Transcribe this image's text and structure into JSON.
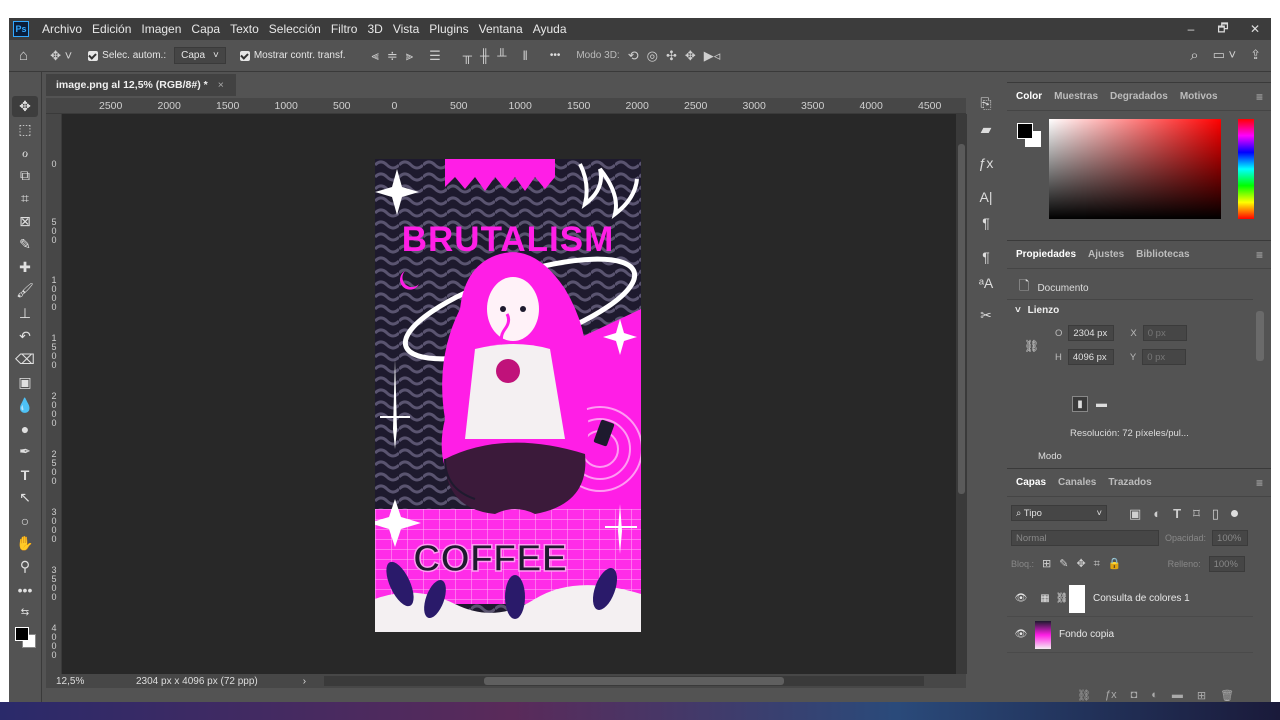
{
  "menubar": {
    "logo": "Ps",
    "items": [
      "Archivo",
      "Edición",
      "Imagen",
      "Capa",
      "Texto",
      "Selección",
      "Filtro",
      "3D",
      "Vista",
      "Plugins",
      "Ventana",
      "Ayuda"
    ],
    "window_controls": [
      "–",
      "🗗",
      "✕"
    ]
  },
  "options_bar": {
    "auto_select_label": "Selec. autom.:",
    "auto_select_target": "Capa",
    "show_transform_label": "Mostrar contr. transf.",
    "mode3d_label": "Modo 3D:",
    "more": "•••"
  },
  "document": {
    "tab_title": "image.png al 12,5% (RGB/8#) *",
    "tab_close": "×",
    "ruler_top_labels": [
      "2500",
      "2000",
      "1500",
      "1000",
      "500",
      "0",
      "500",
      "1000",
      "1500",
      "2000",
      "2500",
      "3000",
      "3500",
      "4000",
      "4500"
    ],
    "ruler_left_labels": [
      "0",
      "5\n0\n0",
      "1\n0\n0\n0",
      "1\n5\n0\n0",
      "2\n0\n0\n0",
      "2\n5\n0\n0",
      "3\n0\n0\n0",
      "3\n5\n0\n0",
      "4\n0\n0\n0"
    ],
    "zoom": "12,5%",
    "dimensions_status": "2304 px x 4096 px (72 ppp)"
  },
  "artwork": {
    "title_text": "BRUTALISM",
    "bottom_text": "COFFEE",
    "colors": {
      "magenta": "#ff1ee6",
      "dark": "#1e1a2e",
      "white": "#f4f0f2"
    }
  },
  "color_panel": {
    "tabs": [
      "Color",
      "Muestras",
      "Degradados",
      "Motivos"
    ],
    "foreground": "#000000",
    "background": "#ffffff",
    "hue": "#ff0000"
  },
  "properties_panel": {
    "tabs": [
      "Propiedades",
      "Ajustes",
      "Bibliotecas"
    ],
    "type_label": "Documento",
    "section": "Lienzo",
    "width_label": "O",
    "width_value": "2304 px",
    "height_label": "H",
    "height_value": "4096 px",
    "x_label": "X",
    "x_placeholder": "0 px",
    "y_label": "Y",
    "y_placeholder": "0 px",
    "resolution": "Resolución: 72 píxeles/pul...",
    "mode_label": "Modo"
  },
  "layers_panel": {
    "tabs": [
      "Capas",
      "Canales",
      "Trazados"
    ],
    "filter_kind": "Tipo",
    "blend_mode": "Normal",
    "opacity_label": "Opacidad:",
    "opacity_value": "100%",
    "lock_label": "Bloq.:",
    "fill_label": "Relleno:",
    "fill_value": "100%",
    "layers": [
      {
        "name": "Consulta de colores 1"
      },
      {
        "name": "Fondo copia"
      }
    ]
  }
}
